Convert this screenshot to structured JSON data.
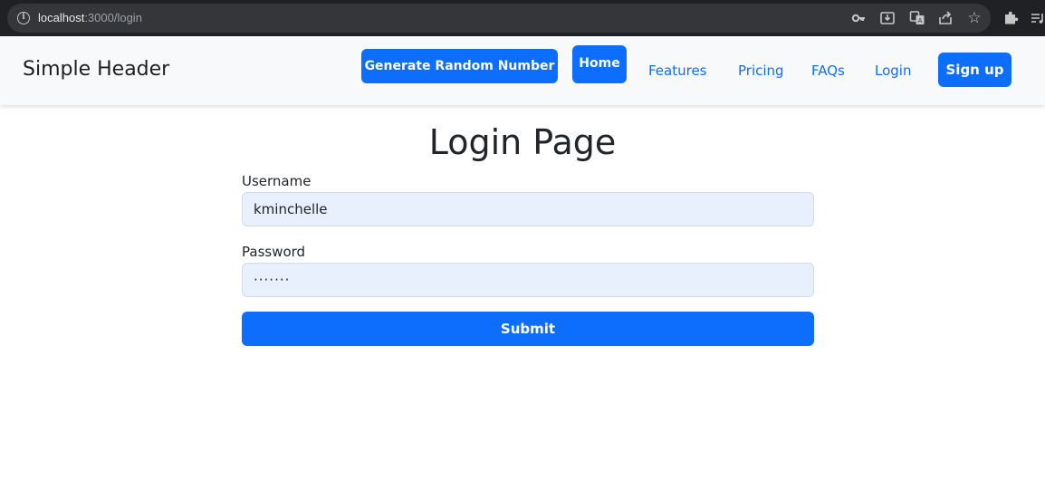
{
  "browser": {
    "url_host": "localhost",
    "url_path": ":3000/login"
  },
  "header": {
    "brand": "Simple Header",
    "generate_button": "Generate Random Number",
    "home_button": "Home",
    "nav_links": [
      "Features",
      "Pricing",
      "FAQs",
      "Login"
    ],
    "signup_button": "Sign up"
  },
  "main": {
    "title": "Login Page",
    "username_label": "Username",
    "username_value": "kminchelle",
    "password_label": "Password",
    "password_value": "·······",
    "submit_label": "Submit"
  },
  "colors": {
    "primary": "#0d6efd",
    "navbar_bg": "#f8f9fa",
    "autofill_bg": "#e8f0fe",
    "chrome_bg": "#202124"
  }
}
